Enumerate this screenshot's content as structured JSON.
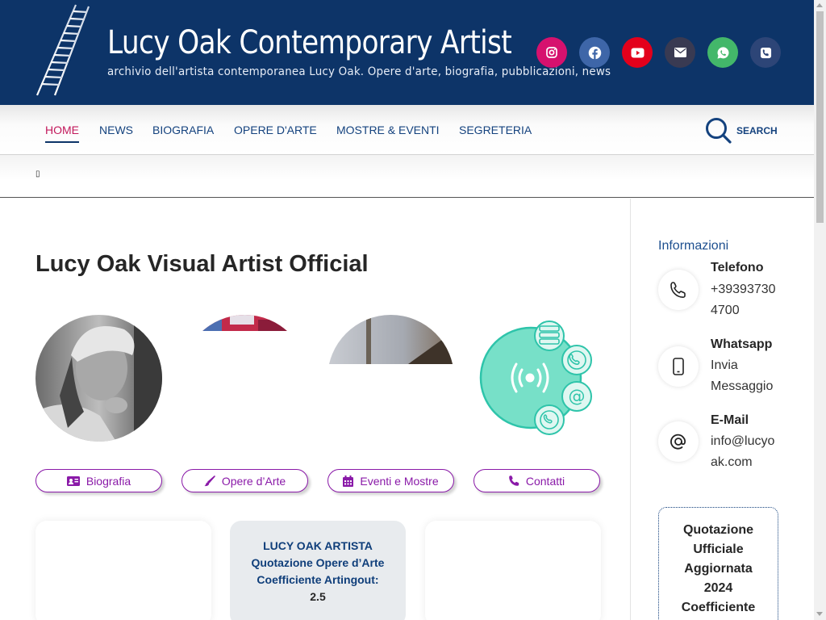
{
  "header": {
    "title": "Lucy Oak Contemporary Artist",
    "tagline": "archivio dell'artista contemporanea Lucy Oak. Opere d'arte, biografia, pubblicazioni, news",
    "socials": [
      {
        "icon": "instagram-icon",
        "color": "#d6116e"
      },
      {
        "icon": "facebook-icon",
        "color": "#3e66a8"
      },
      {
        "icon": "youtube-icon",
        "color": "#e3001b"
      },
      {
        "icon": "email-icon",
        "color": "#393a52"
      },
      {
        "icon": "whatsapp-icon",
        "color": "#43b76a"
      },
      {
        "icon": "phone-icon",
        "color": "#2d4577"
      }
    ]
  },
  "nav": {
    "items": [
      "Home",
      "News",
      "Biografia",
      "Opere d'Arte",
      "Mostre & Eventi",
      "Segreteria"
    ],
    "active": "Home",
    "search_label": "SEARCH"
  },
  "breadcrumb": {
    "icon": "home-icon",
    "glyph": "▯"
  },
  "main": {
    "title": "Lucy Oak Visual Artist Official",
    "buttons": [
      {
        "label": "Biografia",
        "icon": "id-card-icon"
      },
      {
        "label": "Opere d’Arte",
        "icon": "paintbrush-icon"
      },
      {
        "label": "Eventi e Mostre",
        "icon": "calendar-icon"
      },
      {
        "label": "Contatti",
        "icon": "phone-icon"
      }
    ],
    "quote_card": [
      "LUCY OAK ARTISTA",
      "Quotazione Opere d’Arte",
      "Coefficiente Artingout:",
      "2.5"
    ]
  },
  "sidebar": {
    "heading": "Informazioni",
    "items": [
      {
        "title": "Telefono",
        "text": "+393937304700",
        "icon": "phone-icon"
      },
      {
        "title": "Whatsapp",
        "text": "Invia Messaggio",
        "icon": "mobile-icon"
      },
      {
        "title": "E-Mail",
        "text": "info@lucyoak.com",
        "icon": "at-icon"
      }
    ],
    "quote_box": [
      "Quotazione",
      "Ufficiale",
      "Aggiornata",
      "2024",
      "Coefficiente"
    ]
  },
  "colors": {
    "header_bg": "#0d3468",
    "nav_text": "#14427e",
    "active_nav": "#c2185b",
    "pill_accent": "#8a1aa8",
    "teal": "#2ec4aa"
  }
}
